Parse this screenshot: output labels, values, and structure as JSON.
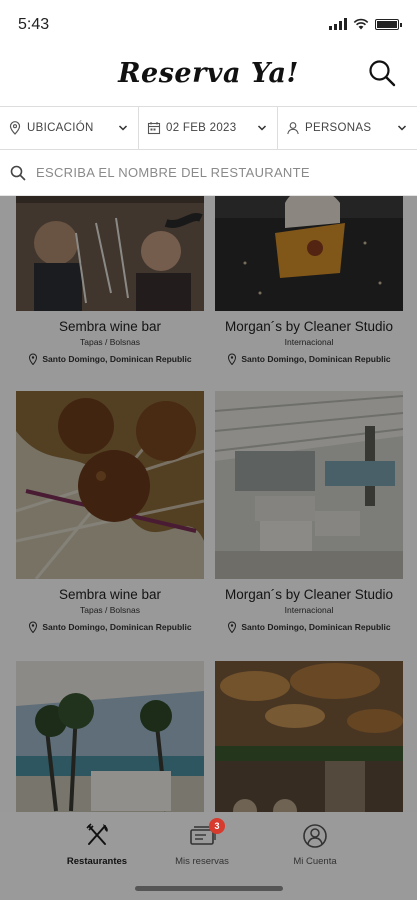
{
  "status_bar": {
    "time": "5:43"
  },
  "header": {
    "title": "Reserva Ya!"
  },
  "filters": {
    "location": "UBICACIÓN",
    "date": "02 FEB 2023",
    "people": "PERSONAS"
  },
  "search": {
    "placeholder": "ESCRIBA EL NOMBRE DEL RESTAURANTE"
  },
  "restaurants": [
    {
      "name": "Sembra wine bar",
      "type": "Tapas / Bolsnas",
      "location": "Santo Domingo, Dominican Republic"
    },
    {
      "name": "Morgan´s by Cleaner Studio",
      "type": "Internacional",
      "location": "Santo Domingo, Dominican Republic"
    },
    {
      "name": "Sembra wine bar",
      "type": "Tapas / Bolsnas",
      "location": "Santo Domingo, Dominican Republic"
    },
    {
      "name": "Morgan´s by Cleaner Studio",
      "type": "Internacional",
      "location": "Santo Domingo, Dominican Republic"
    },
    {
      "name": "",
      "type": "",
      "location": ""
    },
    {
      "name": "",
      "type": "",
      "location": ""
    }
  ],
  "tabbar": {
    "tabs": [
      {
        "label": "Restaurantes",
        "icon": "fork-knife-icon",
        "active": true
      },
      {
        "label": "Mis reservas",
        "icon": "tickets-icon",
        "badge": "3"
      },
      {
        "label": "Mi Cuenta",
        "icon": "user-icon"
      }
    ]
  },
  "colors": {
    "badge": "#d63b2e",
    "tabbar": "#9a9a9a",
    "overlay": "rgba(0,0,0,0.40)"
  }
}
